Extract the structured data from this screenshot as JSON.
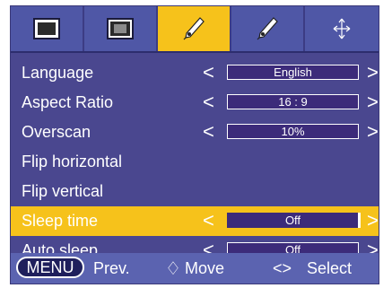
{
  "tabs": [
    {
      "name": "picture",
      "icon": "screen-icon",
      "active": false
    },
    {
      "name": "screen",
      "icon": "screen-inset-icon",
      "active": false
    },
    {
      "name": "options",
      "icon": "pen-icon",
      "active": true
    },
    {
      "name": "options2",
      "icon": "pen-icon",
      "active": false
    },
    {
      "name": "keystone",
      "icon": "arrows-icon",
      "active": false
    }
  ],
  "menu": {
    "items": [
      {
        "label": "Language",
        "value": "English",
        "selected": false
      },
      {
        "label": "Aspect Ratio",
        "value": "16 : 9",
        "selected": false
      },
      {
        "label": "Overscan",
        "value": "10%",
        "selected": false
      },
      {
        "label": "Flip horizontal",
        "value": null,
        "selected": false
      },
      {
        "label": "Flip vertical",
        "value": null,
        "selected": false
      },
      {
        "label": "Sleep time",
        "value": "Off",
        "selected": true
      },
      {
        "label": "Auto sleep",
        "value": "Off",
        "selected": false
      }
    ],
    "arrow_left": "<",
    "arrow_right": ">"
  },
  "footer": {
    "menu_button": "MENU",
    "prev": "Prev.",
    "move_icon": "♢",
    "move": "Move",
    "select_icon": "<>",
    "select": "Select"
  },
  "colors": {
    "background": "#4a478f",
    "highlight": "#f6c21b",
    "tabbar": "#4f57a6",
    "footer": "#5b63b0",
    "valuebox": "#3c2b7a"
  }
}
